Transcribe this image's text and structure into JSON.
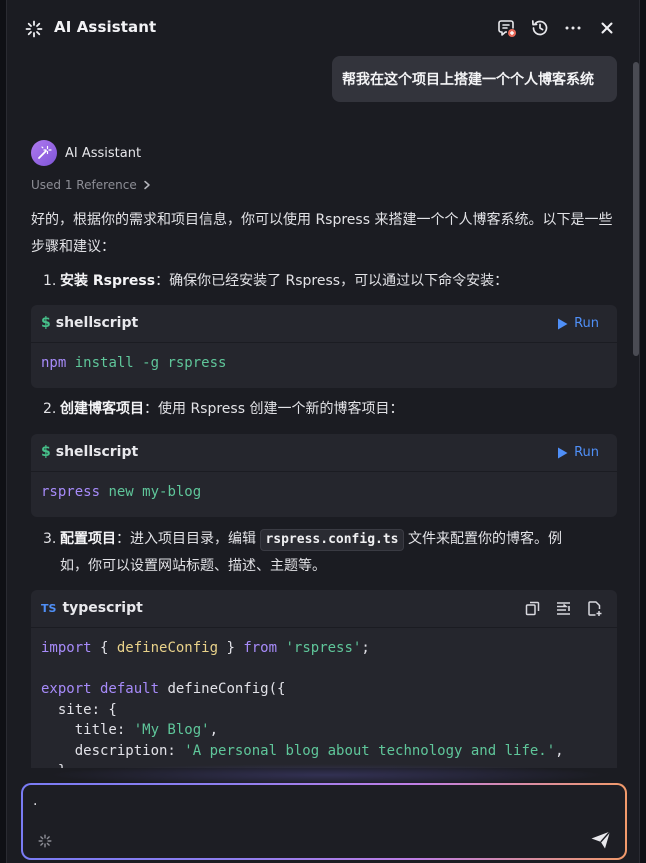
{
  "header": {
    "title": "AI Assistant",
    "icons": [
      "sparkle-icon",
      "new-chat-icon",
      "history-icon",
      "more-icon",
      "close-icon"
    ]
  },
  "user_message": "帮我在这个项目上搭建一个个人博客系统",
  "assistant": {
    "name": "AI Assistant",
    "references": "Used 1 Reference",
    "intro": "好的，根据你的需求和项目信息，你可以使用 Rspress 来搭建一个个人博客系统。以下是一些步骤和建议：",
    "steps": [
      {
        "num": "1.",
        "bold": "安装 Rspress",
        "text": "：确保你已经安装了 Rspress，可以通过以下命令安装："
      },
      {
        "num": "2.",
        "bold": "创建博客项目",
        "text": "：使用 Rspress 创建一个新的博客项目："
      },
      {
        "num": "3.",
        "bold": "配置项目",
        "text_before": "：进入项目目录，编辑 ",
        "code": "rspress.config.ts",
        "text_after": " 文件来配置你的博客。例",
        "text_line2": "如，你可以设置网站标题、描述、主题等。"
      }
    ],
    "code_blocks": [
      {
        "lang": "shellscript",
        "run_label": "Run",
        "lines": [
          [
            "npm",
            " install -g rspress"
          ]
        ]
      },
      {
        "lang": "shellscript",
        "run_label": "Run",
        "lines": [
          [
            "rspress",
            " new my-blog"
          ]
        ]
      },
      {
        "lang": "typescript",
        "lang_badge": "TS",
        "tokens": {
          "l1_import": "import",
          "l1_open": " { ",
          "l1_name": "defineConfig",
          "l1_close": " } ",
          "l1_from": "from",
          "l1_str": "'rspress'",
          "l1_end": ";",
          "l3_export": "export",
          "l3_default": " default",
          "l3_fn": " defineConfig({",
          "l4": "  site: {",
          "l5_key": "    title: ",
          "l5_val": "'My Blog'",
          "l5_end": ",",
          "l6_key": "    description: ",
          "l6_val": "'A personal blog about technology and life.'",
          "l6_end": ",",
          "l7": "  },"
        }
      }
    ]
  },
  "input": {
    "value": "."
  },
  "colors": {
    "accent": "#4f8ff7",
    "keyword": "#a78bfa",
    "string": "#5fc69a",
    "identifier": "#e9d28a"
  }
}
